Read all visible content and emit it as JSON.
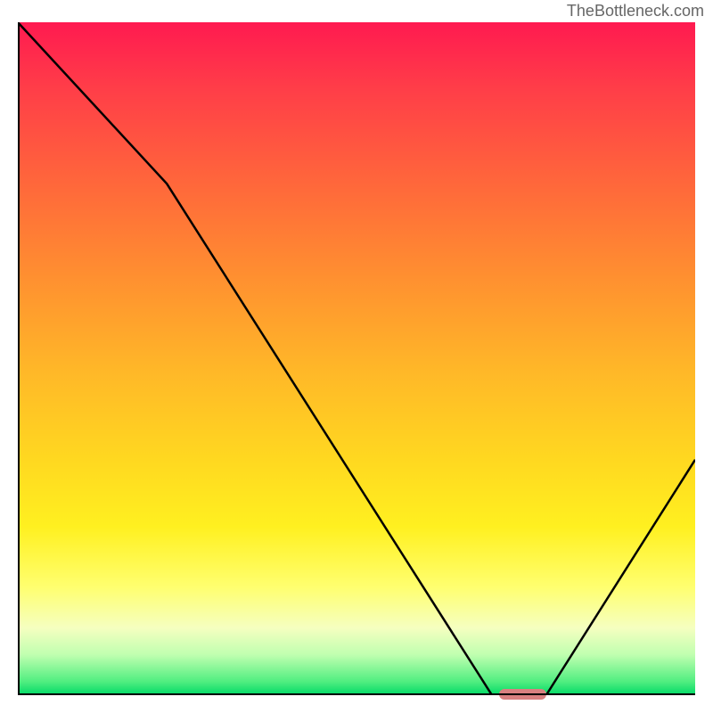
{
  "watermark": "TheBottleneck.com",
  "chart_data": {
    "type": "line",
    "title": "",
    "xlabel": "",
    "ylabel": "",
    "xlim": [
      0,
      100
    ],
    "ylim": [
      0,
      100
    ],
    "gradient_colors": {
      "top": "#ff1a50",
      "mid_upper": "#ff9030",
      "mid": "#ffd820",
      "mid_lower": "#ffff70",
      "bottom": "#00d966"
    },
    "series": [
      {
        "name": "bottleneck-curve",
        "x": [
          0,
          22,
          70,
          78,
          100
        ],
        "y": [
          100,
          76,
          0,
          0,
          35
        ],
        "color": "#000000"
      }
    ],
    "optimal_marker": {
      "x_start": 71,
      "x_end": 78,
      "y": 0,
      "color": "#d98080"
    }
  }
}
